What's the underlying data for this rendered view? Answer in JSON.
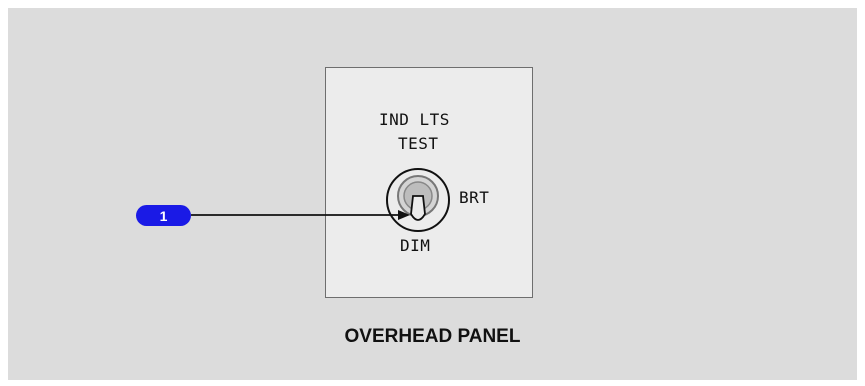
{
  "caption": "OVERHEAD PANEL",
  "panel": {
    "label_line1": "IND LTS",
    "label_line2": "TEST",
    "position_right": "BRT",
    "position_bottom": "DIM"
  },
  "callout": {
    "number": "1",
    "color": "#1a1ae6"
  }
}
